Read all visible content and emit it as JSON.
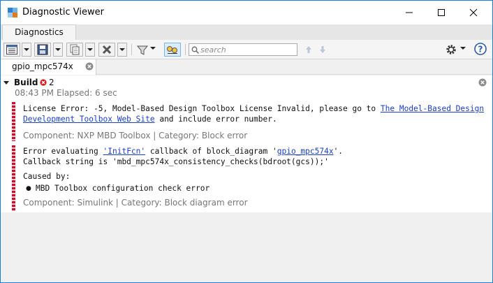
{
  "window": {
    "title": "Diagnostic Viewer"
  },
  "ribbon": {
    "tab_label": "Diagnostics"
  },
  "toolbar": {
    "search_placeholder": "search"
  },
  "doc_tab": {
    "label": "gpio_mpc574x"
  },
  "build": {
    "label": "Build",
    "error_count": "2",
    "time": "08:43 PM",
    "elapsed": "Elapsed: 6 sec"
  },
  "messages": [
    {
      "line1_prefix": "License Error: -5, Model-Based Design Toolbox License Invalid, please go to ",
      "line1_link": "The Model-Based Design ",
      "line2_link": "Development Toolbox Web Site",
      "line2_suffix": " and include error number.",
      "component": "Component: NXP MBD Toolbox | Category: Block error"
    },
    {
      "line1_prefix": "Error evaluating ",
      "line1_link1": "'InitFcn'",
      "line1_mid": " callback of block_diagram '",
      "line1_link2": "gpio_mpc574x",
      "line1_suffix": "'.",
      "line2": "Callback string is 'mbd_mpc574x_consistency_checks(bdroot(gcs));'",
      "caused_by": "Caused by:",
      "cause_item": "MBD Toolbox configuration check error",
      "component": "Component: Simulink | Category: Block diagram error"
    }
  ],
  "colors": {
    "error_red": "#c8102e",
    "link_blue": "#1a3fc4",
    "window_border": "#1a7fd6"
  }
}
